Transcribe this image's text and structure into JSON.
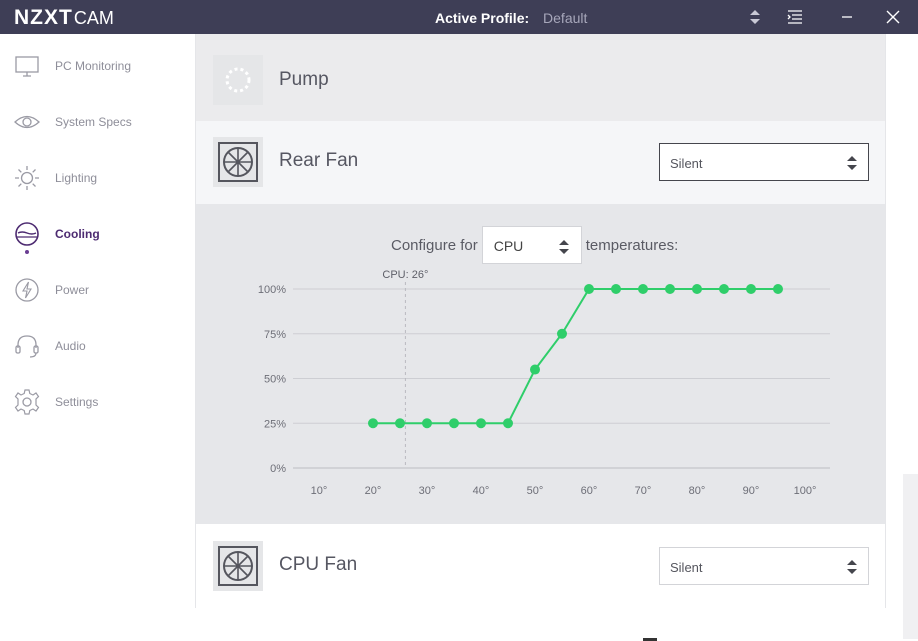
{
  "app": {
    "brand_main": "NZXT",
    "brand_sub": "CAM"
  },
  "header": {
    "profile_label": "Active Profile:",
    "profile_value": "Default"
  },
  "titlebar_icons": [
    "sort-arrows-icon",
    "menu-icon",
    "minimize-icon",
    "close-icon"
  ],
  "sidebar": {
    "items": [
      {
        "label": "PC Monitoring",
        "icon": "monitor-icon"
      },
      {
        "label": "System Specs",
        "icon": "eye-icon"
      },
      {
        "label": "Lighting",
        "icon": "sun-icon"
      },
      {
        "label": "Cooling",
        "icon": "cooling-icon",
        "active": true
      },
      {
        "label": "Power",
        "icon": "power-icon"
      },
      {
        "label": "Audio",
        "icon": "headset-icon"
      },
      {
        "label": "Settings",
        "icon": "gear-icon"
      }
    ]
  },
  "devices": {
    "pump": {
      "title": "Pump"
    },
    "rear_fan": {
      "title": "Rear Fan",
      "mode": "Silent"
    },
    "cpu_fan": {
      "title": "CPU Fan",
      "mode": "Silent"
    }
  },
  "graph": {
    "configure_prefix": "Configure for",
    "source": "CPU",
    "configure_suffix": "temperatures:",
    "marker_label": "CPU: 26°"
  },
  "chart_data": {
    "type": "line",
    "title": "",
    "xlabel": "",
    "ylabel": "",
    "x_ticks": [
      "10°",
      "20°",
      "30°",
      "40°",
      "50°",
      "60°",
      "70°",
      "80°",
      "90°",
      "100°"
    ],
    "y_ticks": [
      "0%",
      "25%",
      "50%",
      "75%",
      "100%"
    ],
    "xlim": [
      10,
      100
    ],
    "ylim": [
      0,
      100
    ],
    "x": [
      20,
      25,
      30,
      35,
      40,
      45,
      50,
      55,
      60,
      65,
      70,
      75,
      80,
      85,
      90,
      95
    ],
    "y": [
      25,
      25,
      25,
      25,
      25,
      25,
      55,
      75,
      100,
      100,
      100,
      100,
      100,
      100,
      100,
      100
    ],
    "marker_x": 26,
    "line_color": "#2fce6a",
    "grid": true
  },
  "colors": {
    "accent": "#4d2b71",
    "titlebar": "#3e3e56",
    "curve": "#2fce6a"
  }
}
